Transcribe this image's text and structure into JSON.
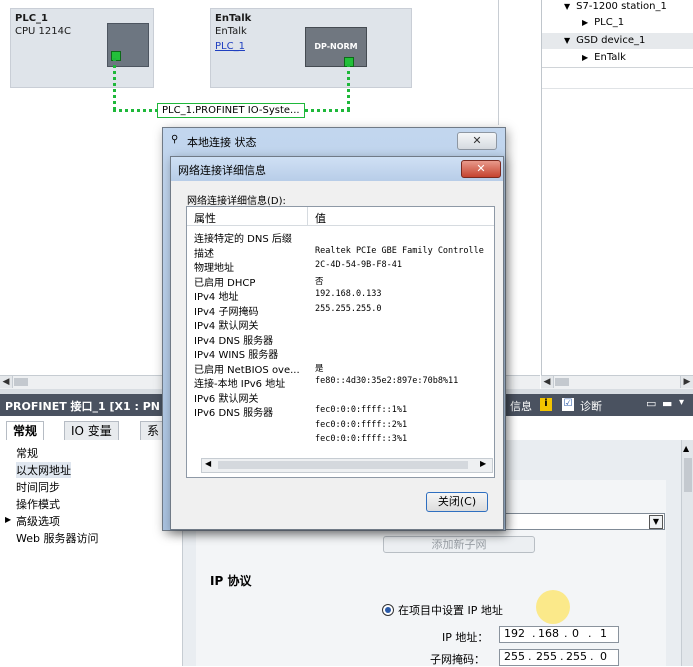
{
  "network": {
    "plc": {
      "name": "PLC_1",
      "cpu": "CPU 1214C"
    },
    "entalk": {
      "name": "EnTalk",
      "type": "EnTalk",
      "link": "PLC_1",
      "module": "DP-NORM"
    },
    "subnet_label": "PLC_1.PROFINET IO-Syste..."
  },
  "tree": {
    "items": [
      {
        "label": "S7-1200 station_1"
      },
      {
        "label": "PLC_1"
      },
      {
        "label": "GSD device_1"
      },
      {
        "label": "EnTalk"
      }
    ]
  },
  "properties": {
    "title": "PROFINET 接口_1 [X1 : PN",
    "right_info": "信息",
    "right_diag": "诊断",
    "tabs": [
      {
        "label": "常规"
      },
      {
        "label": "IO 变量"
      },
      {
        "label": "系"
      }
    ],
    "nav": [
      {
        "label": "常规"
      },
      {
        "label": "以太网地址"
      },
      {
        "label": "时间同步"
      },
      {
        "label": "操作模式"
      },
      {
        "label": "高级选项"
      },
      {
        "label": "Web 服务器访问"
      }
    ],
    "add_subnet": "添加新子网",
    "ip_section": "IP 协议",
    "ip_radio": "在项目中设置 IP 地址",
    "ip_label": "IP 地址：",
    "mask_label": "子网掩码：",
    "ip_octets": [
      "192",
      "168",
      "0",
      "1"
    ],
    "mask_octets": [
      "255",
      "255",
      "255",
      "0"
    ]
  },
  "status_dialog": {
    "title": "本地连接 状态"
  },
  "details_dialog": {
    "title": "网络连接详细信息",
    "caption": "网络连接详细信息(D):",
    "col_property": "属性",
    "col_value": "值",
    "rows": [
      {
        "k": "连接特定的 DNS 后缀",
        "v": ""
      },
      {
        "k": "描述",
        "v": "Realtek PCIe GBE Family Controlle"
      },
      {
        "k": "物理地址",
        "v": "2C-4D-54-9B-F8-41"
      },
      {
        "k": "已启用 DHCP",
        "v": "否"
      },
      {
        "k": "IPv4 地址",
        "v": "192.168.0.133"
      },
      {
        "k": "IPv4 子网掩码",
        "v": "255.255.255.0"
      },
      {
        "k": "IPv4 默认网关",
        "v": ""
      },
      {
        "k": "IPv4 DNS 服务器",
        "v": ""
      },
      {
        "k": "IPv4 WINS 服务器",
        "v": ""
      },
      {
        "k": "已启用 NetBIOS ove...",
        "v": "是"
      },
      {
        "k": "连接-本地 IPv6 地址",
        "v": "fe80::4d30:35e2:897e:70b8%11"
      },
      {
        "k": "IPv6 默认网关",
        "v": ""
      },
      {
        "k": "IPv6 DNS 服务器",
        "v": "fec0:0:0:ffff::1%1"
      },
      {
        "k": "",
        "v": "fec0:0:0:ffff::2%1"
      },
      {
        "k": "",
        "v": "fec0:0:0:ffff::3%1"
      }
    ],
    "close_label": "关闭(C)"
  },
  "colors": {
    "accent_green": "#1eb83a",
    "title_bar": "#4a5260",
    "close_red": "#c5432f"
  }
}
